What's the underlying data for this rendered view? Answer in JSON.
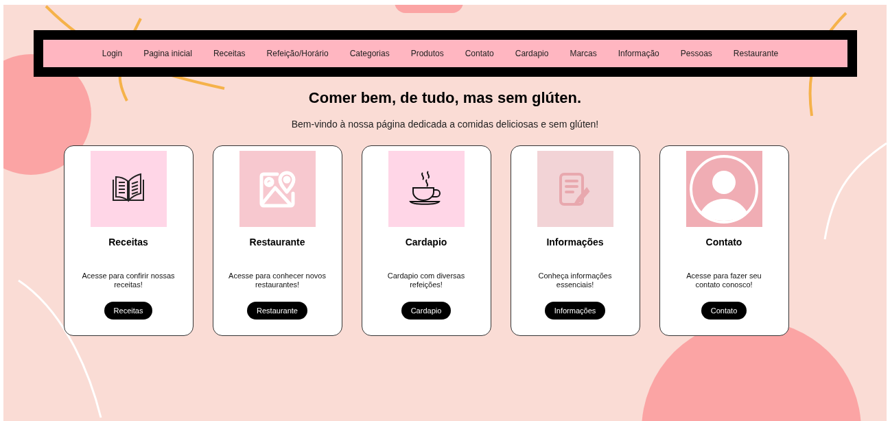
{
  "nav": {
    "items": [
      "Login",
      "Pagina inicial",
      "Receitas",
      "Refeição/Horário",
      "Categorias",
      "Produtos",
      "Contato",
      "Cardapio",
      "Marcas",
      "Informação",
      "Pessoas",
      "Restaurante"
    ]
  },
  "heading": "Comer bem, de tudo, mas sem glúten.",
  "subtitle": "Bem-vindo à nossa página dedicada a comidas deliciosas e sem glúten!",
  "cards": [
    {
      "title": "Receitas",
      "description": "Acesse para confirir nossas receitas!",
      "button": "Receitas",
      "color": "#ffd6e7"
    },
    {
      "title": "Restaurante",
      "description": "Acesse para conhecer novos restaurantes!",
      "button": "Restaurante",
      "color": "#f7c8cf"
    },
    {
      "title": "Cardapio",
      "description": "Cardapio com diversas refeições!",
      "button": "Cardapio",
      "color": "#ffd6e7"
    },
    {
      "title": "Informações",
      "description": "Conheça informações essenciais!",
      "button": "Informações",
      "color": "#f2d3d6"
    },
    {
      "title": "Contato",
      "description": "Acesse para fazer seu contato conosco!",
      "button": "Contato",
      "color": "#f0adb4"
    }
  ]
}
